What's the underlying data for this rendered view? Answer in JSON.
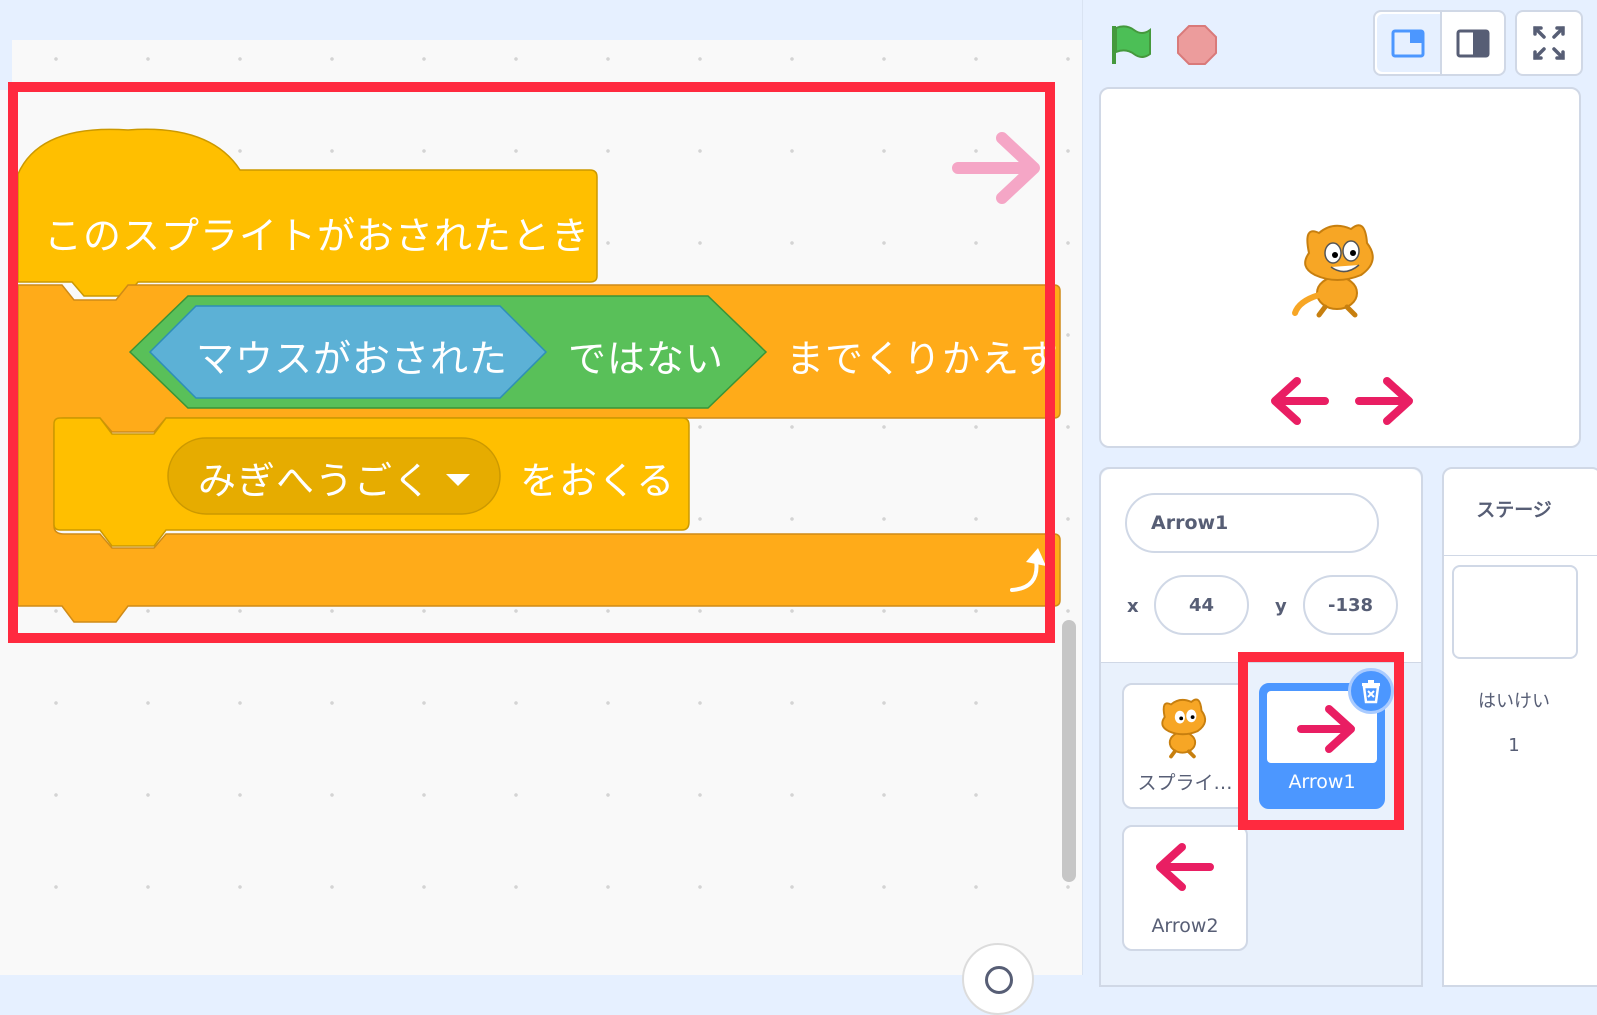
{
  "script": {
    "hat_label": "このスプライトがおされたとき",
    "repeat_until_label": "までくりかえす",
    "sensing_label": "マウスがおされた",
    "not_label": "ではない",
    "broadcast_menu_value": "みぎへうごく",
    "broadcast_suffix": "をおくる"
  },
  "colors": {
    "events": "#ffbf00",
    "control": "#ffab19",
    "sensing": "#5cb1d6",
    "operators": "#59c059",
    "highlight": "#ff2a3f",
    "arrow": "#e91e63"
  },
  "header": {
    "green_flag_icon": "green-flag-icon",
    "stop_icon": "stop-icon"
  },
  "sprite_info": {
    "name": "Arrow1",
    "x_label": "x",
    "x_value": "44",
    "y_label": "y",
    "y_value": "-138"
  },
  "sprites": [
    {
      "name": "スプライ…",
      "icon": "cat-icon"
    },
    {
      "name": "Arrow1",
      "icon": "arrow-right-icon",
      "selected": true
    },
    {
      "name": "Arrow2",
      "icon": "arrow-left-icon"
    }
  ],
  "stage_panel": {
    "title": "ステージ",
    "backdrops_label": "はいけい",
    "backdrops_count": "1"
  }
}
